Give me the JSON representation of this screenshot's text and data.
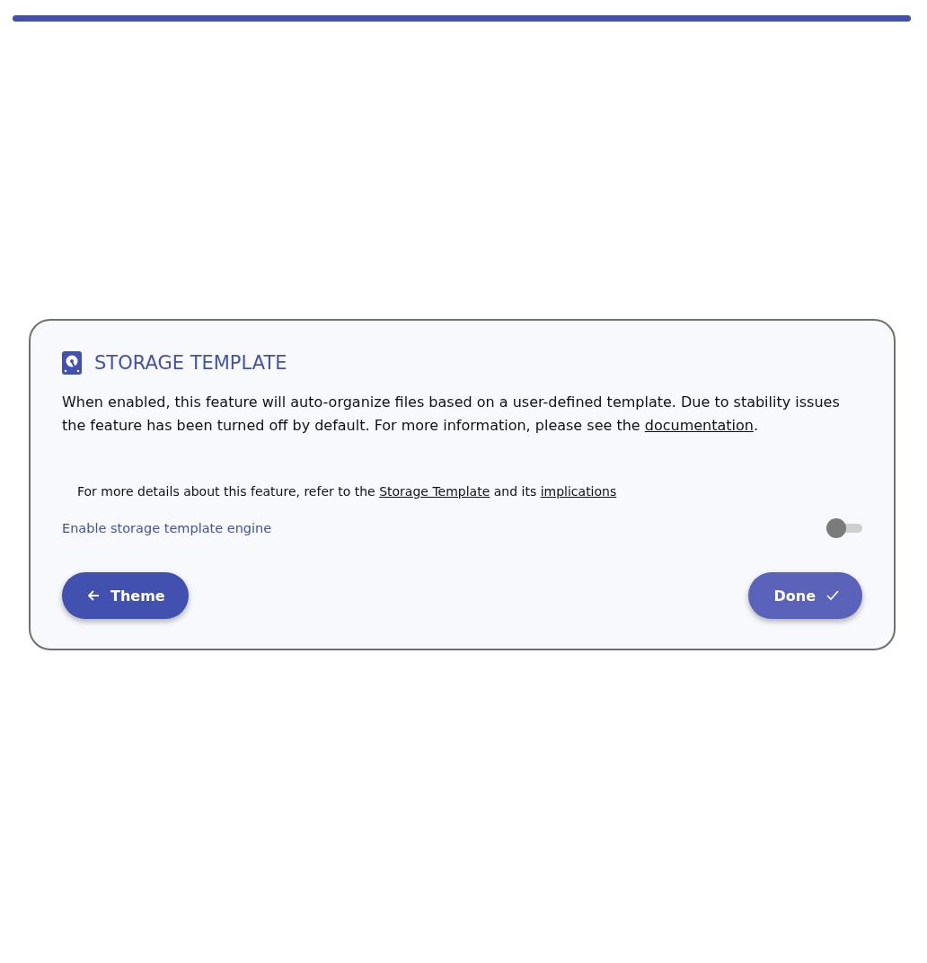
{
  "progress": {
    "level": 1
  },
  "card": {
    "title": "STORAGE TEMPLATE",
    "description": {
      "text": "When enabled, this feature will auto-organize files based on a user-defined template. Due to stability issues the feature has been turned off by default. For more information, please see the ",
      "link": "documentation",
      "end": "."
    },
    "details": {
      "text": "For more details about this feature, refer to the ",
      "link1": "Storage Template",
      "middle": " and its ",
      "link2": "implications"
    },
    "setting": {
      "label": "Enable storage template engine",
      "on": false
    },
    "buttons": [
      {
        "label": "Theme",
        "kind": "back",
        "hovered": false
      },
      {
        "label": "Done",
        "kind": "done",
        "hovered": true
      }
    ]
  }
}
